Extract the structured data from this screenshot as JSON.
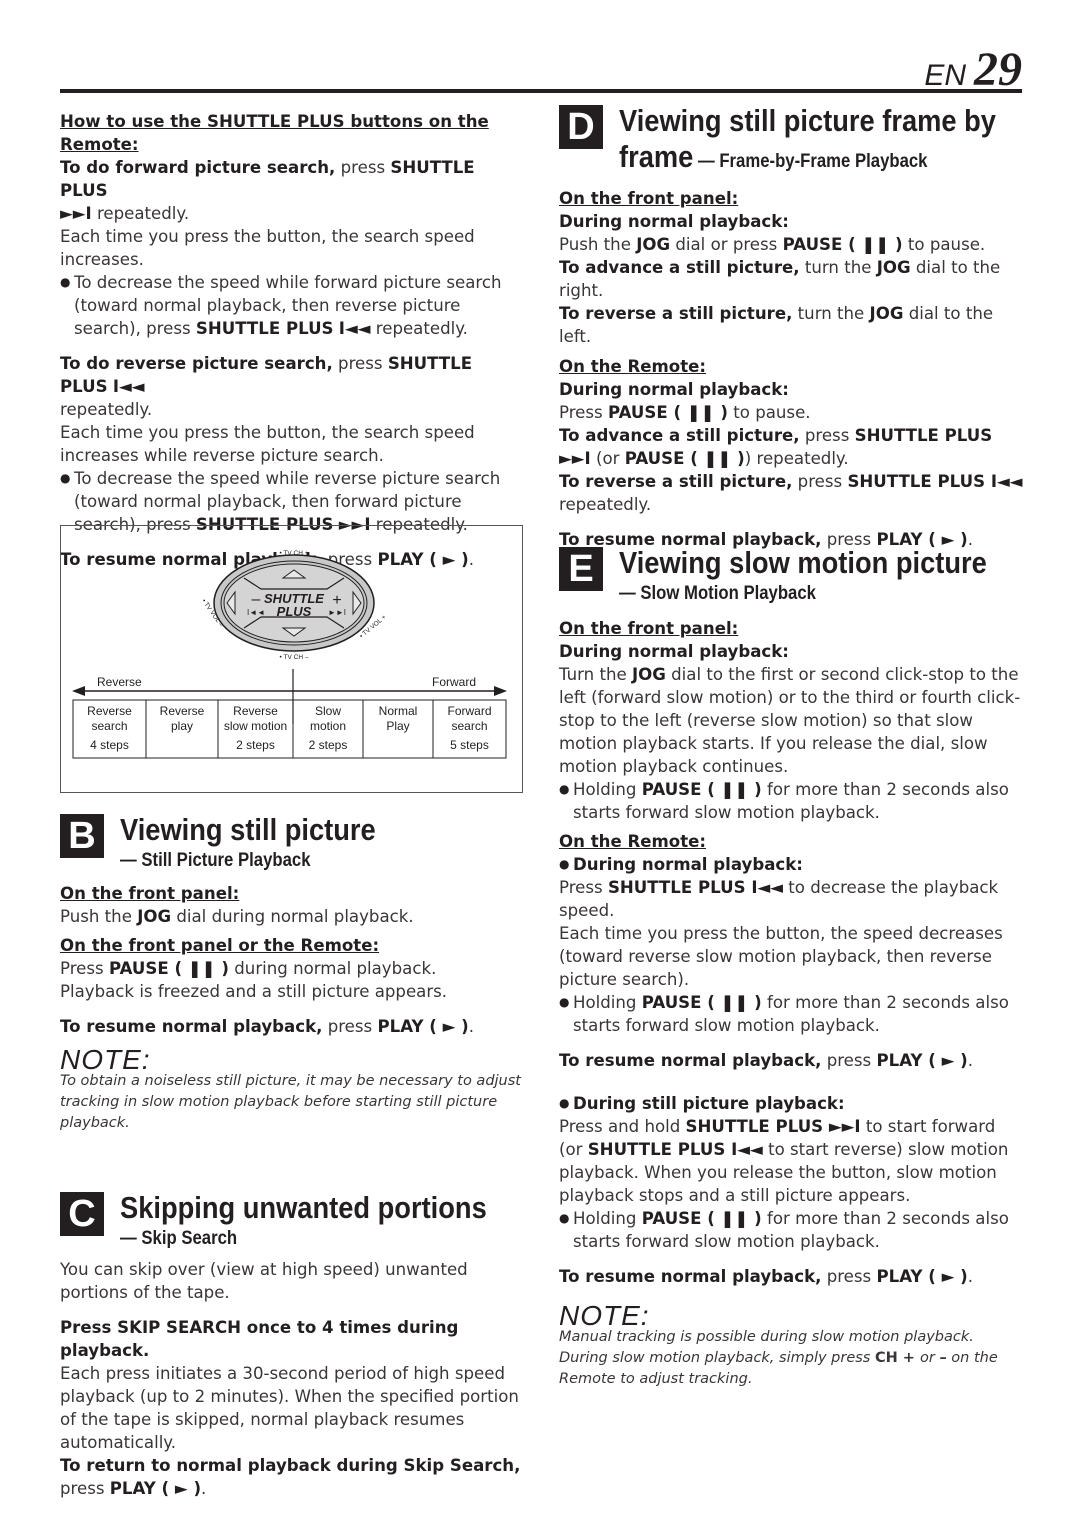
{
  "page": {
    "lang": "EN",
    "number": "29"
  },
  "left": {
    "shuttle_heading": "How to use the SHUTTLE PLUS buttons on the Remote:",
    "fwd_lead": "To do forward picture search,",
    "fwd_press": " press ",
    "fwd_button": "SHUTTLE PLUS",
    "fwd_icon": "►►I",
    "fwd_rest": " repeatedly.",
    "fwd_each": "Each time you press the button, the search speed increases.",
    "fwd_bullet_1": "To decrease the speed while forward picture search (toward normal playback, then reverse picture search), press ",
    "fwd_bullet_btn": "SHUTTLE PLUS",
    "fwd_bullet_icon": "I◄◄",
    "fwd_bullet_rest": " repeatedly.",
    "rev_lead": "To do reverse picture search,",
    "rev_press": " press ",
    "rev_button": "SHUTTLE PLUS",
    "rev_icon": "I◄◄",
    "rev_rest": " repeatedly.",
    "rev_each": "Each time you press the button, the search speed increases while reverse picture search.",
    "rev_bullet_1": "To decrease the speed while reverse picture search (toward normal playback, then forward picture search), press ",
    "rev_bullet_btn": "SHUTTLE PLUS",
    "rev_bullet_icon": "►►I",
    "rev_bullet_rest": " repeatedly.",
    "resume_lead": "To resume normal playback,",
    "resume_press": " press ",
    "resume_btn": "PLAY ( ► )",
    "resume_end": "."
  },
  "diagram": {
    "tv_ch_plus": "• TV CH +",
    "tv_ch_minus": "• TV CH –",
    "tv_vol_minus": "• TV VOL –",
    "tv_vol_plus": "• TV VOL +",
    "shuttle": "SHUTTLE",
    "plus": "PLUS",
    "minus_sign": "–",
    "plus_sign": "+",
    "rew_icon": "I◄◄",
    "ff_icon": "►►I",
    "reverse_label": "Reverse",
    "forward_label": "Forward",
    "cells": [
      {
        "line1": "Reverse",
        "line2": "search",
        "steps": "4 steps"
      },
      {
        "line1": "Reverse",
        "line2": "play",
        "steps": ""
      },
      {
        "line1": "Reverse",
        "line2": "slow motion",
        "steps": "2 steps"
      },
      {
        "line1": "Slow",
        "line2": "motion",
        "steps": "2 steps"
      },
      {
        "line1": "Normal",
        "line2": "Play",
        "steps": ""
      },
      {
        "line1": "Forward",
        "line2": "search",
        "steps": "5 steps"
      }
    ]
  },
  "section_b": {
    "letter": "B",
    "title": "Viewing still picture",
    "subtitle": "— Still Picture Playback",
    "front_panel": "On the front panel:",
    "push_pre": "Push the ",
    "push_jog": "JOG",
    "push_rest": " dial during normal playback.",
    "front_or_remote": "On the front panel or the Remote:",
    "press_pre": "Press ",
    "press_btn": "PAUSE ( ❚❚ )",
    "press_rest": " during normal playback.",
    "freezed": "Playback is freezed and a still picture appears.",
    "resume_lead": "To resume normal playback,",
    "resume_press": " press ",
    "resume_btn": "PLAY ( ► )",
    "resume_end": "."
  },
  "note_b": {
    "heading": "NOTE:",
    "body": "To obtain a noiseless still picture, it may be necessary to adjust tracking in slow motion playback before starting still picture playback."
  },
  "section_c": {
    "letter": "C",
    "title": "Skipping unwanted portions",
    "subtitle": "— Skip Search",
    "intro": "You can skip over (view at high speed) unwanted portions of the tape.",
    "press_line": "Press SKIP SEARCH once to 4 times during playback.",
    "each_press": "Each press initiates a 30-second period of high speed playback (up to 2 minutes). When the specified portion of the tape is skipped, normal playback resumes automatically.",
    "return_lead": "To return to normal playback during Skip Search,",
    "return_press": " press ",
    "return_btn": "PLAY ( ► )",
    "return_end": "."
  },
  "section_d": {
    "letter": "D",
    "title": "Viewing still picture frame by",
    "title2": "frame",
    "subtitle": " — Frame-by-Frame Playback",
    "front_panel": "On the front panel:",
    "during": "During normal playback:",
    "push_pre": "Push the ",
    "push_jog": "JOG",
    "push_mid": " dial or press ",
    "push_btn": "PAUSE ( ❚❚ )",
    "push_rest": " to pause.",
    "adv_lead": "To advance a still picture,",
    "adv_mid": " turn the ",
    "adv_jog": "JOG",
    "adv_rest": " dial to the right.",
    "rev_lead": "To reverse a still picture,",
    "rev_mid": " turn the ",
    "rev_jog": "JOG",
    "rev_rest": " dial to the left.",
    "remote": "On the Remote:",
    "during2": "During normal playback:",
    "press_pre": "Press ",
    "press_btn": "PAUSE ( ❚❚ )",
    "press_rest": " to pause.",
    "radv_lead": "To advance a still picture,",
    "radv_press": " press ",
    "radv_btn": "SHUTTLE PLUS ►►I",
    "radv_or": " (or ",
    "radv_pause": "PAUSE ( ❚❚ )",
    "radv_rest": ") repeatedly.",
    "rrev_lead": "To reverse a still picture,",
    "rrev_press": " press ",
    "rrev_btn": "SHUTTLE PLUS I◄◄",
    "rrev_rest": " repeatedly.",
    "resume_lead": "To resume normal playback,",
    "resume_press": " press ",
    "resume_btn": "PLAY ( ► )",
    "resume_end": "."
  },
  "section_e": {
    "letter": "E",
    "title": "Viewing slow motion picture",
    "subtitle": "— Slow Motion Playback",
    "front_panel": "On the front panel:",
    "during": "During normal playback:",
    "turn_pre": "Turn the ",
    "turn_jog": "JOG",
    "turn_rest": " dial to the first or second click-stop to the left (forward slow motion) or to the third or fourth click-stop to the left (reverse slow motion) so that slow motion playback starts. If you release the dial, slow motion playback continues.",
    "hold_pre": "Holding ",
    "hold_btn": "PAUSE ( ❚❚ )",
    "hold_rest": " for more than 2 seconds also starts forward slow motion playback.",
    "remote": "On the Remote:",
    "during_remote": "During normal playback:",
    "dec_pre": "Press ",
    "dec_btn": "SHUTTLE PLUS I◄◄",
    "dec_rest": " to decrease the playback speed.",
    "dec_each": "Each time you press the button, the speed decreases (toward reverse slow motion playback, then reverse picture search).",
    "hold2_pre": "Holding ",
    "hold2_btn": "PAUSE ( ❚❚ )",
    "hold2_rest": " for more than 2 seconds also starts forward slow motion playback.",
    "resume_lead": "To resume normal playback,",
    "resume_press": " press ",
    "resume_btn": "PLAY ( ► )",
    "resume_end": ".",
    "still_head": "During still picture playback:",
    "still_pre": "Press and hold ",
    "still_btn1": "SHUTTLE PLUS ►►I",
    "still_mid": " to start forward (or ",
    "still_btn2": "SHUTTLE PLUS I◄◄",
    "still_rest": " to start reverse) slow motion playback. When you release the button, slow motion playback stops and a still picture appears.",
    "hold3_pre": "Holding ",
    "hold3_btn": "PAUSE ( ❚❚ )",
    "hold3_rest": " for more than 2 seconds also starts forward slow motion playback.",
    "resume2_lead": "To resume normal playback,",
    "resume2_press": " press ",
    "resume2_btn": "PLAY ( ► )",
    "resume2_end": "."
  },
  "note_e": {
    "heading": "NOTE:",
    "body_pre": "Manual tracking is possible during slow motion playback. During slow motion playback, simply press ",
    "body_btn": "CH + ",
    "body_mid": "or ",
    "body_dash": "–",
    "body_rest": " on the Remote to adjust tracking."
  }
}
